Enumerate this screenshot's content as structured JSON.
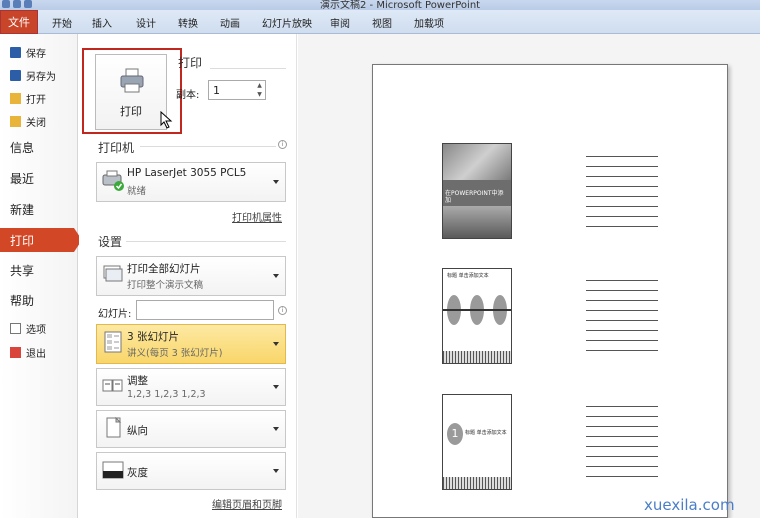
{
  "window": {
    "title": "演示文稿2 - Microsoft PowerPoint"
  },
  "ribbon": {
    "file_tab": "文件",
    "tabs": [
      "开始",
      "插入",
      "设计",
      "转换",
      "动画",
      "幻灯片放映",
      "审阅",
      "视图",
      "加载项"
    ]
  },
  "nav": {
    "save": "保存",
    "save_as": "另存为",
    "open": "打开",
    "close": "关闭",
    "info": "信息",
    "recent": "最近",
    "new": "新建",
    "print": "打印",
    "share": "共享",
    "help": "帮助",
    "options": "选项",
    "exit": "退出"
  },
  "print_panel": {
    "print_button": "打印",
    "heading": "打印",
    "copies_label": "副本:",
    "copies_value": "1",
    "printer_heading": "打印机",
    "printer_name": "HP LaserJet 3055 PCL5",
    "printer_status": "就绪",
    "printer_properties": "打印机属性",
    "settings_heading": "设置",
    "range_main": "打印全部幻灯片",
    "range_sub": "打印整个演示文稿",
    "slides_label": "幻灯片:",
    "slides_value": "",
    "layout_main": "3 张幻灯片",
    "layout_sub": "讲义(每页 3 张幻灯片)",
    "collate_main": "调整",
    "collate_sub": "1,2,3    1,2,3    1,2,3",
    "orientation": "纵向",
    "color": "灰度",
    "header_footer": "编辑页眉和页脚"
  },
  "preview": {
    "slide1_text": "在POWERPOINT中添加",
    "slide2_title": "标题 单击添加文本",
    "slide3_title": "标题 单击添加文本",
    "slide3_number": "1"
  },
  "watermark": "xuexila.com",
  "colors": {
    "accent": "#d24726",
    "highlight": "#f9d66a",
    "red_box": "#c0271f"
  }
}
